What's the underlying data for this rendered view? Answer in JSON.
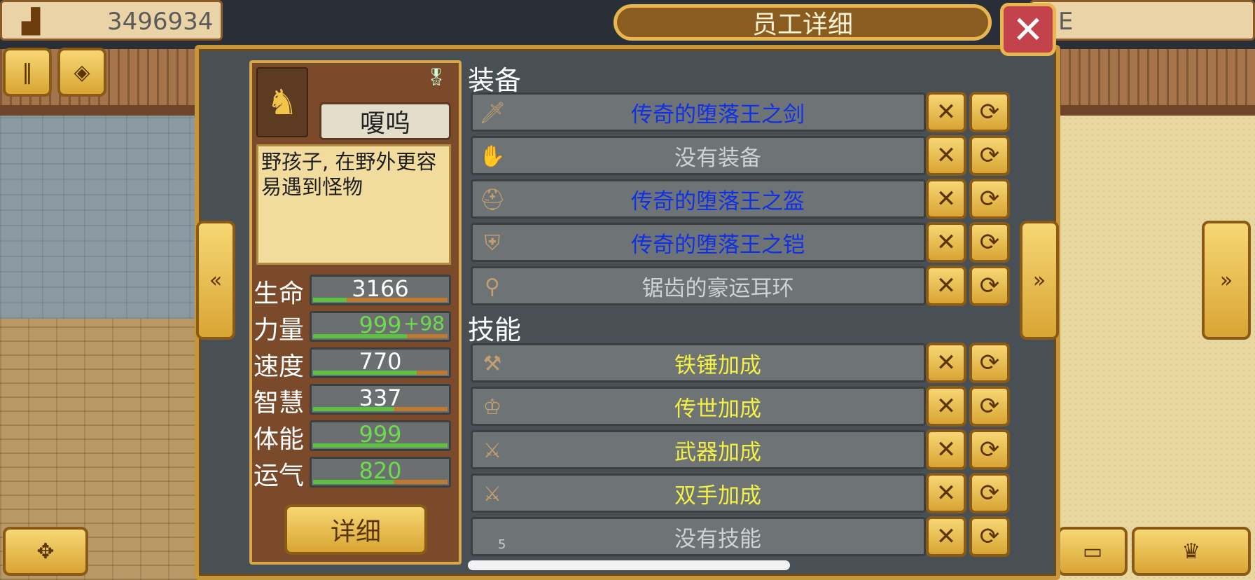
{
  "topbar": {
    "money_icon": "bar-chart-icon",
    "money": "3496934",
    "right_fragment": "E"
  },
  "panel": {
    "title": "员工详细",
    "close_icon": "close-icon"
  },
  "character": {
    "portrait_icon": "lion-warrior-icon",
    "name": "嗄呜",
    "description": "野孩子, 在野外更容易遇到怪物",
    "medal_icon": "medal-icon",
    "stats": [
      {
        "label": "生命",
        "value": "3166",
        "bonus": "",
        "fill": 0.25,
        "color": "#ffffff"
      },
      {
        "label": "力量",
        "value": "999",
        "bonus": "+98",
        "fill": 0.7,
        "color": "#6cdc4c"
      },
      {
        "label": "速度",
        "value": "770",
        "bonus": "",
        "fill": 0.77,
        "color": "#ffffff"
      },
      {
        "label": "智慧",
        "value": "337",
        "bonus": "",
        "fill": 0.6,
        "color": "#ffffff"
      },
      {
        "label": "体能",
        "value": "999",
        "bonus": "",
        "fill": 1.0,
        "color": "#6cdc4c"
      },
      {
        "label": "运气",
        "value": "820",
        "bonus": "",
        "fill": 0.6,
        "color": "#6cdc4c"
      }
    ],
    "detail_button": "详细"
  },
  "equipment": {
    "title": "装备",
    "items": [
      {
        "icon": "sword-icon",
        "name": "传奇的堕落王之剑",
        "color": "#1030e8"
      },
      {
        "icon": "gauntlet-icon",
        "name": "没有装备",
        "color": "#cfd2d2"
      },
      {
        "icon": "helmet-icon",
        "name": "传奇的堕落王之盔",
        "color": "#1030e8"
      },
      {
        "icon": "armor-icon",
        "name": "传奇的堕落王之铠",
        "color": "#1030e8"
      },
      {
        "icon": "earring-icon",
        "name": "锯齿的豪运耳环",
        "color": "#cfd2d2"
      }
    ]
  },
  "skills": {
    "title": "技能",
    "items": [
      {
        "icon": "hammer-icon",
        "name": "铁锤加成",
        "color": "#f2f044"
      },
      {
        "icon": "crown-icon",
        "name": "传世加成",
        "color": "#f2f044"
      },
      {
        "icon": "mace-icon",
        "name": "武器加成",
        "color": "#f2f044"
      },
      {
        "icon": "greatsword-icon",
        "name": "双手加成",
        "color": "#f2f044"
      },
      {
        "icon": "empty-slot-icon",
        "name": "没有技能",
        "color": "#cfd2d2",
        "badge": "5"
      }
    ]
  },
  "buttons": {
    "remove_icon": "x-icon",
    "swap_icon": "swap-icon",
    "prev_icon": "left-arrow-icon",
    "next_icon": "right-arrow-icon"
  }
}
